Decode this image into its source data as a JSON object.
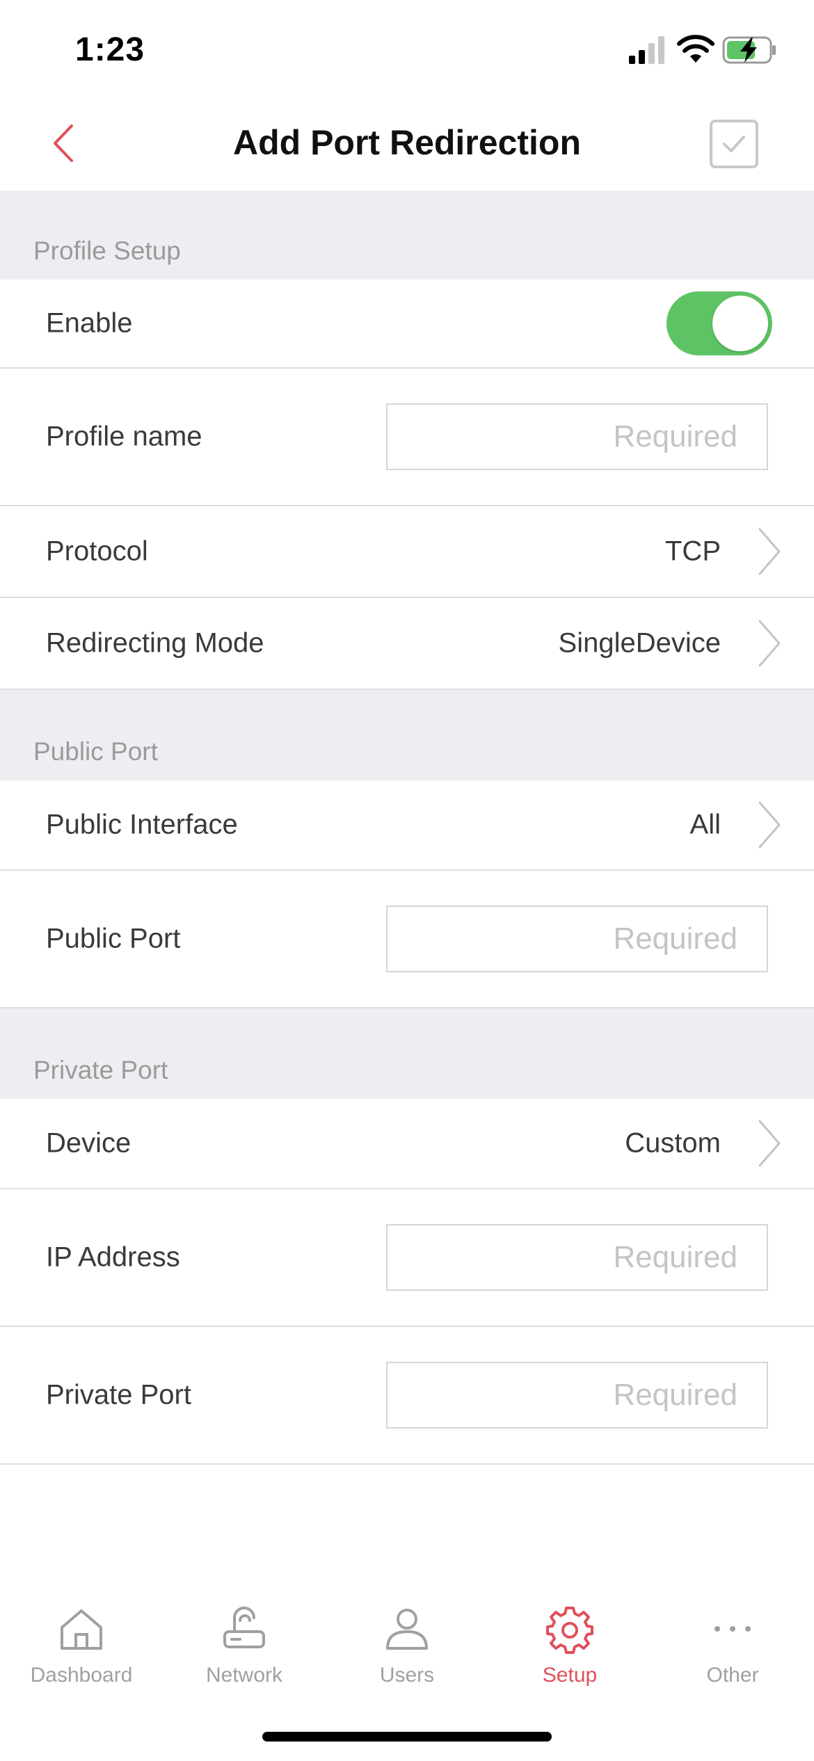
{
  "status_bar": {
    "time": "1:23",
    "icons": [
      "signal-icon",
      "wifi-icon",
      "battery-charging-icon"
    ]
  },
  "nav": {
    "title": "Add Port Redirection",
    "back_icon": "chevron-left-icon",
    "confirm_icon": "checkbox-check-icon",
    "accent_color": "#e0505a"
  },
  "sections": {
    "profile_setup": {
      "header": "Profile Setup",
      "enable": {
        "label": "Enable",
        "on": true,
        "color": "#5ec364"
      },
      "profile_name": {
        "label": "Profile name",
        "placeholder": "Required",
        "value": ""
      },
      "protocol": {
        "label": "Protocol",
        "value": "TCP"
      },
      "redirecting_mode": {
        "label": "Redirecting Mode",
        "value": "SingleDevice"
      }
    },
    "public_port": {
      "header": "Public Port",
      "public_interface": {
        "label": "Public Interface",
        "value": "All"
      },
      "public_port": {
        "label": "Public Port",
        "placeholder": "Required",
        "value": ""
      }
    },
    "private_port": {
      "header": "Private Port",
      "device": {
        "label": "Device",
        "value": "Custom"
      },
      "ip_address": {
        "label": "IP Address",
        "placeholder": "Required",
        "value": ""
      },
      "private_port": {
        "label": "Private Port",
        "placeholder": "Required",
        "value": ""
      }
    }
  },
  "tab_bar": {
    "active": "Setup",
    "active_color": "#e0505a",
    "inactive_color": "#a0a0a0",
    "items": [
      {
        "label": "Dashboard",
        "icon": "home-icon"
      },
      {
        "label": "Network",
        "icon": "router-icon"
      },
      {
        "label": "Users",
        "icon": "user-icon"
      },
      {
        "label": "Setup",
        "icon": "gear-icon"
      },
      {
        "label": "Other",
        "icon": "more-dots-icon"
      }
    ]
  }
}
